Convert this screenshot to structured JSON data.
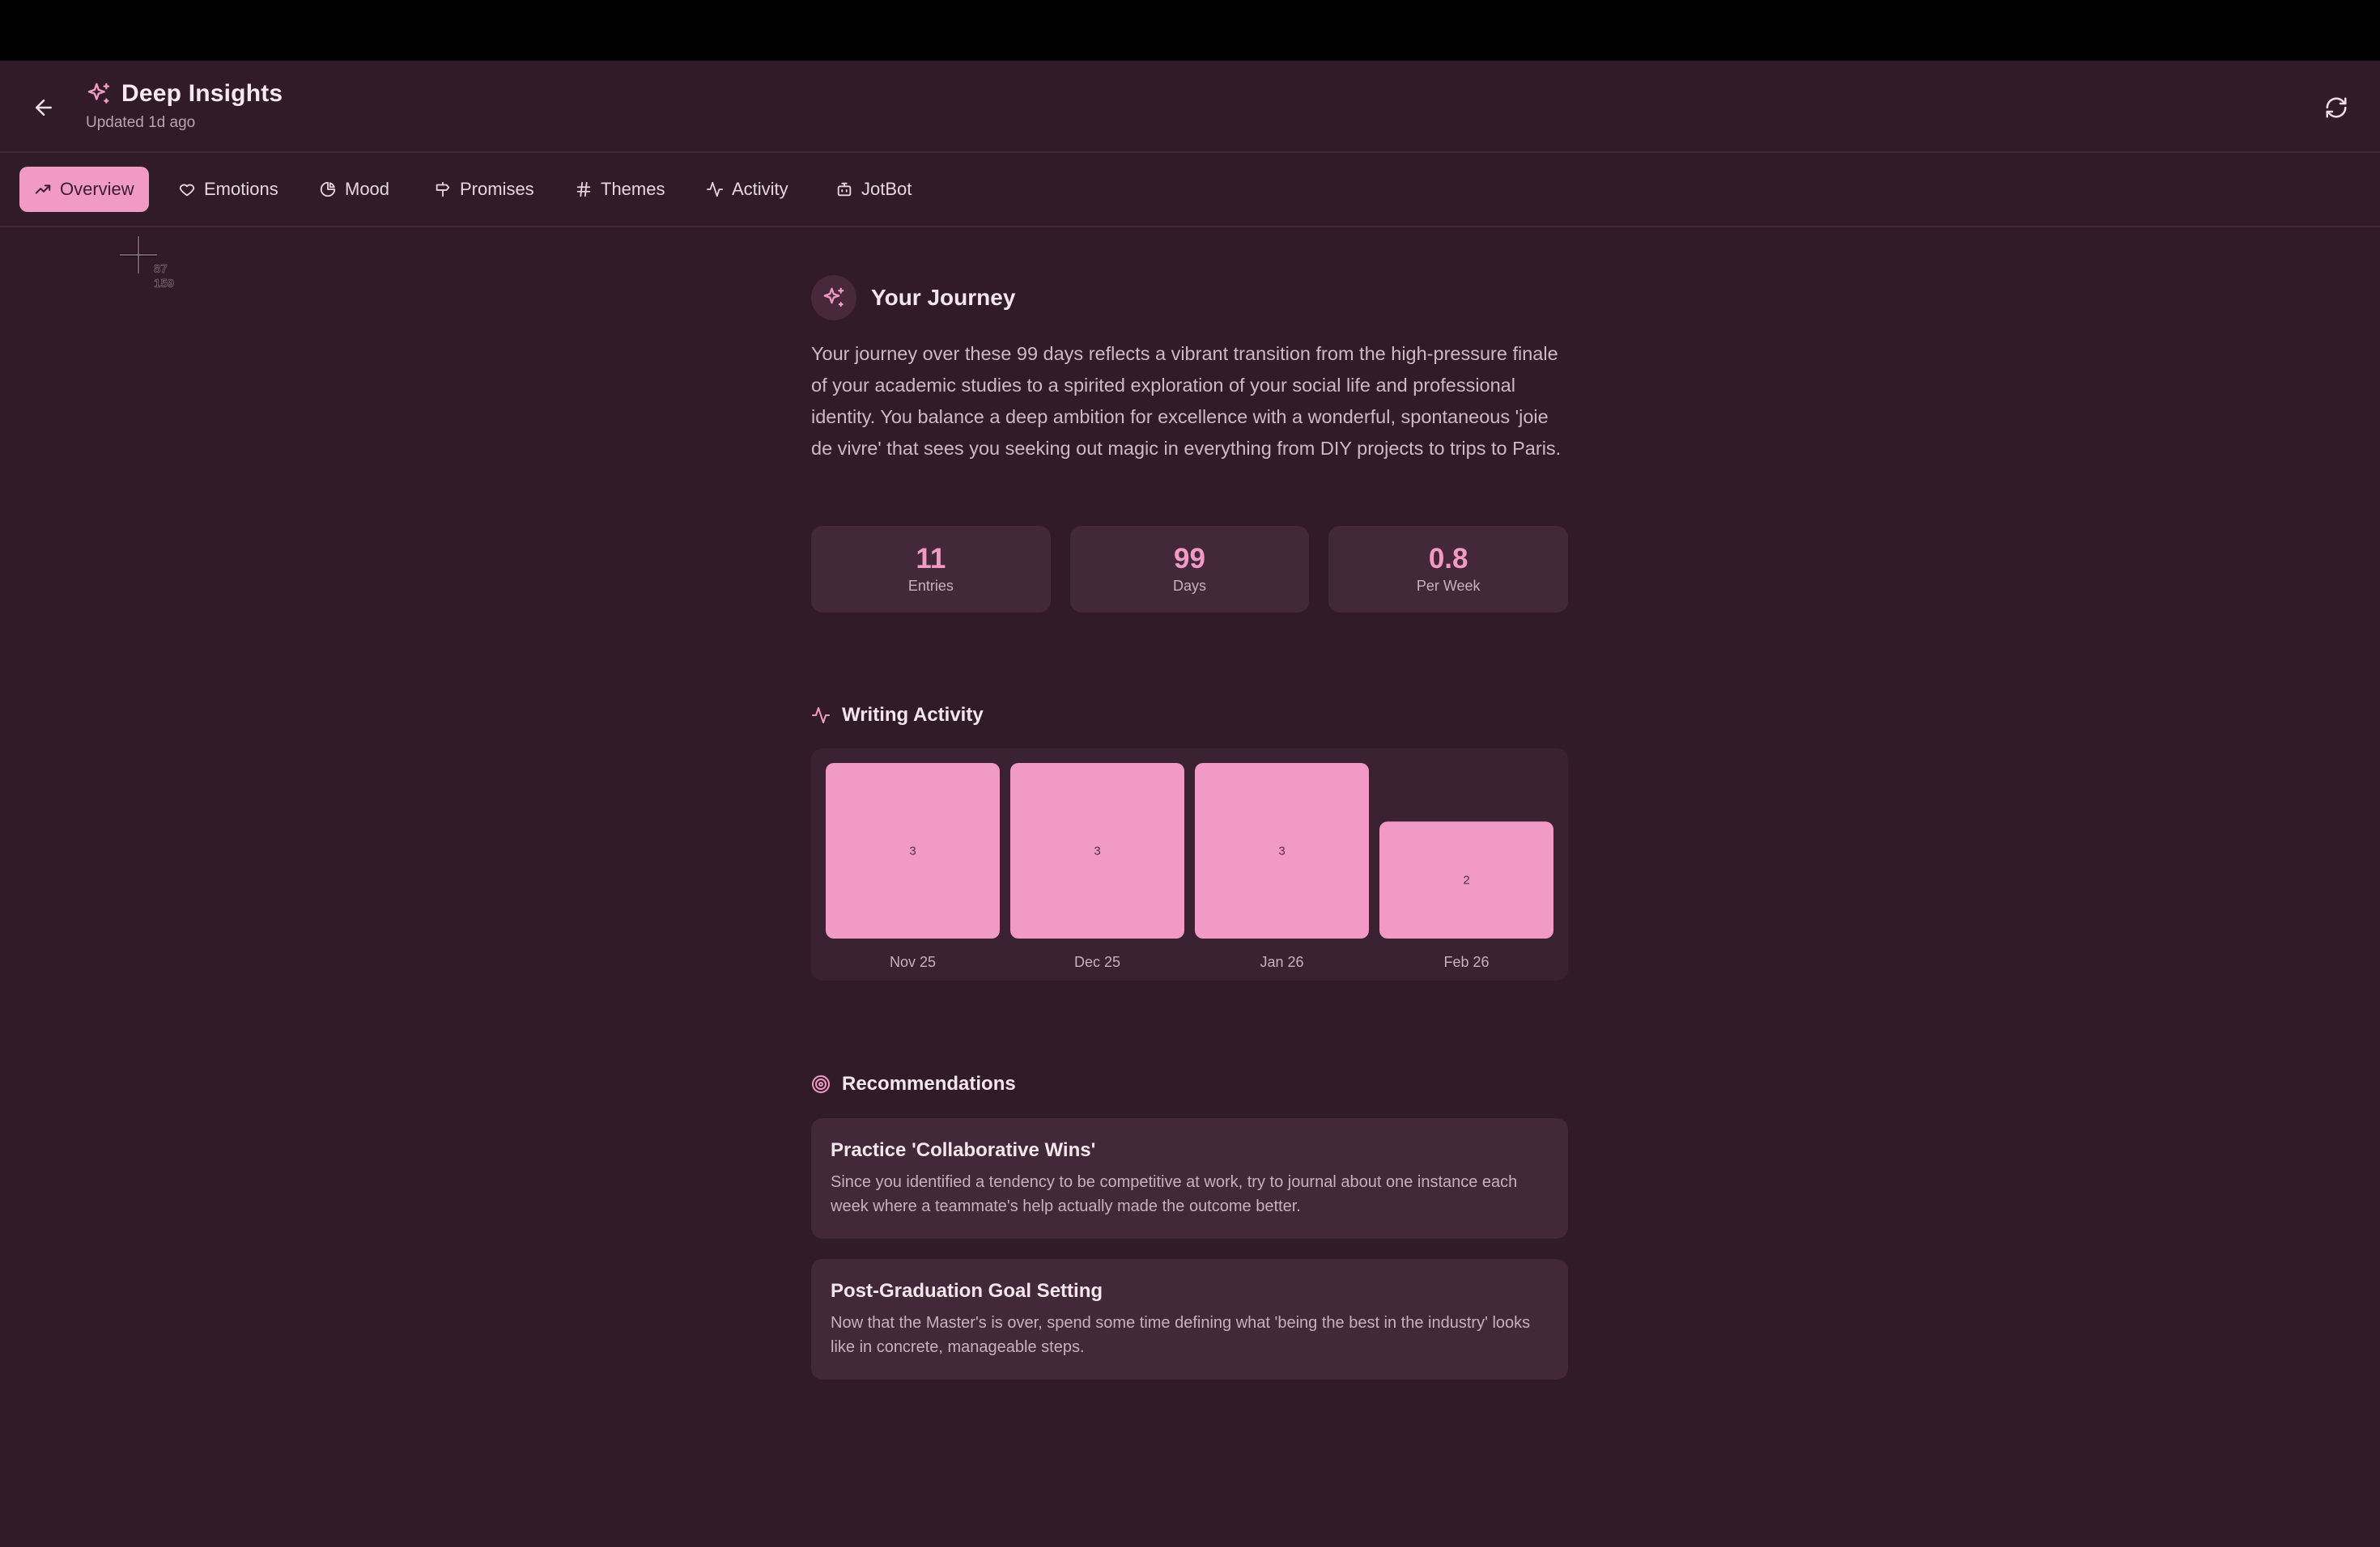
{
  "header": {
    "title": "Deep Insights",
    "subtitle": "Updated 1d ago"
  },
  "tabs": [
    {
      "label": "Overview",
      "icon": "trending-up-icon",
      "active": true
    },
    {
      "label": "Emotions",
      "icon": "heart-icon",
      "active": false
    },
    {
      "label": "Mood",
      "icon": "pie-chart-icon",
      "active": false
    },
    {
      "label": "Promises",
      "icon": "signpost-icon",
      "active": false
    },
    {
      "label": "Themes",
      "icon": "hash-icon",
      "active": false
    },
    {
      "label": "Activity",
      "icon": "activity-icon",
      "active": false
    },
    {
      "label": "JotBot",
      "icon": "bot-icon",
      "active": false
    }
  ],
  "cursor": {
    "x_label": "87",
    "y_label": "159"
  },
  "journey": {
    "title": "Your Journey",
    "text": "Your journey over these 99 days reflects a vibrant transition from the high-pressure finale of your academic studies to a spirited exploration of your social life and professional identity. You balance a deep ambition for excellence with a wonderful, spontaneous 'joie de vivre' that sees you seeking out magic in everything from DIY projects to trips to Paris."
  },
  "stats": [
    {
      "value": "11",
      "label": "Entries"
    },
    {
      "value": "99",
      "label": "Days"
    },
    {
      "value": "0.8",
      "label": "Per Week"
    }
  ],
  "writing_activity": {
    "title": "Writing Activity"
  },
  "chart_data": {
    "type": "bar",
    "categories": [
      "Nov 25",
      "Dec 25",
      "Jan 26",
      "Feb 26"
    ],
    "values": [
      3,
      3,
      3,
      2
    ],
    "title": "Writing Activity",
    "xlabel": "",
    "ylabel": "",
    "ylim": [
      0,
      3
    ],
    "grid": false,
    "bar_color": "#f19ac6"
  },
  "recommendations": {
    "title": "Recommendations",
    "items": [
      {
        "title": "Practice 'Collaborative Wins'",
        "body": "Since you identified a tendency to be competitive at work, try to journal about one instance each week where a teammate's help actually made the outcome better."
      },
      {
        "title": "Post-Graduation Goal Setting",
        "body": "Now that the Master's is over, spend some time defining what 'being the best in the industry' looks like in concrete, manageable steps."
      }
    ]
  },
  "colors": {
    "background": "#321b28",
    "accent": "#f19ac6",
    "card": "#43283a"
  }
}
